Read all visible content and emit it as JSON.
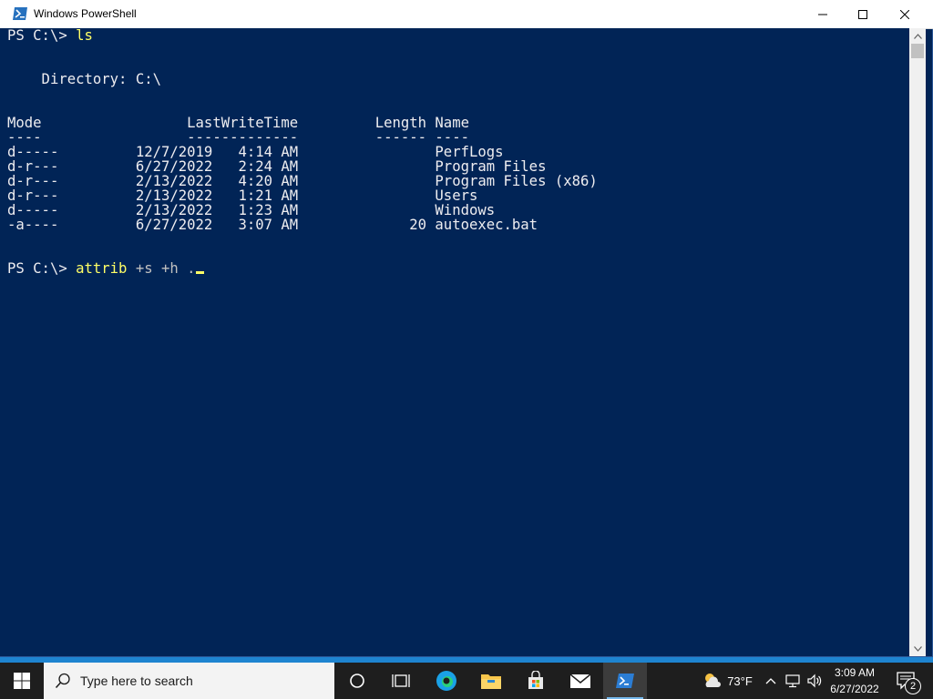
{
  "window": {
    "title": "Windows PowerShell"
  },
  "console": {
    "lines": {
      "prompt1": "PS C:\\> ",
      "cmd1": "ls",
      "blank1": "",
      "directory": "    Directory: C:\\",
      "blank2": "",
      "header": "Mode                 LastWriteTime         Length Name",
      "underline": "----                 -------------         ------ ----",
      "row1": "d-----         12/7/2019   4:14 AM                PerfLogs",
      "row2": "d-r---         6/27/2022   2:24 AM                Program Files",
      "row3": "d-r---         2/13/2022   4:20 AM                Program Files (x86)",
      "row4": "d-r---         2/13/2022   1:21 AM                Users",
      "row5": "d-----         2/13/2022   1:23 AM                Windows",
      "row6": "-a----         6/27/2022   3:07 AM             20 autoexec.bat",
      "blank3": "",
      "prompt2": "PS C:\\> ",
      "cmd2": "attrib",
      "cmd2_args": " +s +h ."
    }
  },
  "taskbar": {
    "search_placeholder": "Type here to search",
    "weather": "73°F",
    "time": "3:09 AM",
    "date": "6/27/2022",
    "notification_count": "2"
  },
  "colors": {
    "console_bg": "#012456",
    "console_fg": "#eeedf0",
    "command_fg": "#ffff66",
    "taskbar_bg": "#1e1e1e",
    "desktop_bg": "#1e84d0"
  }
}
